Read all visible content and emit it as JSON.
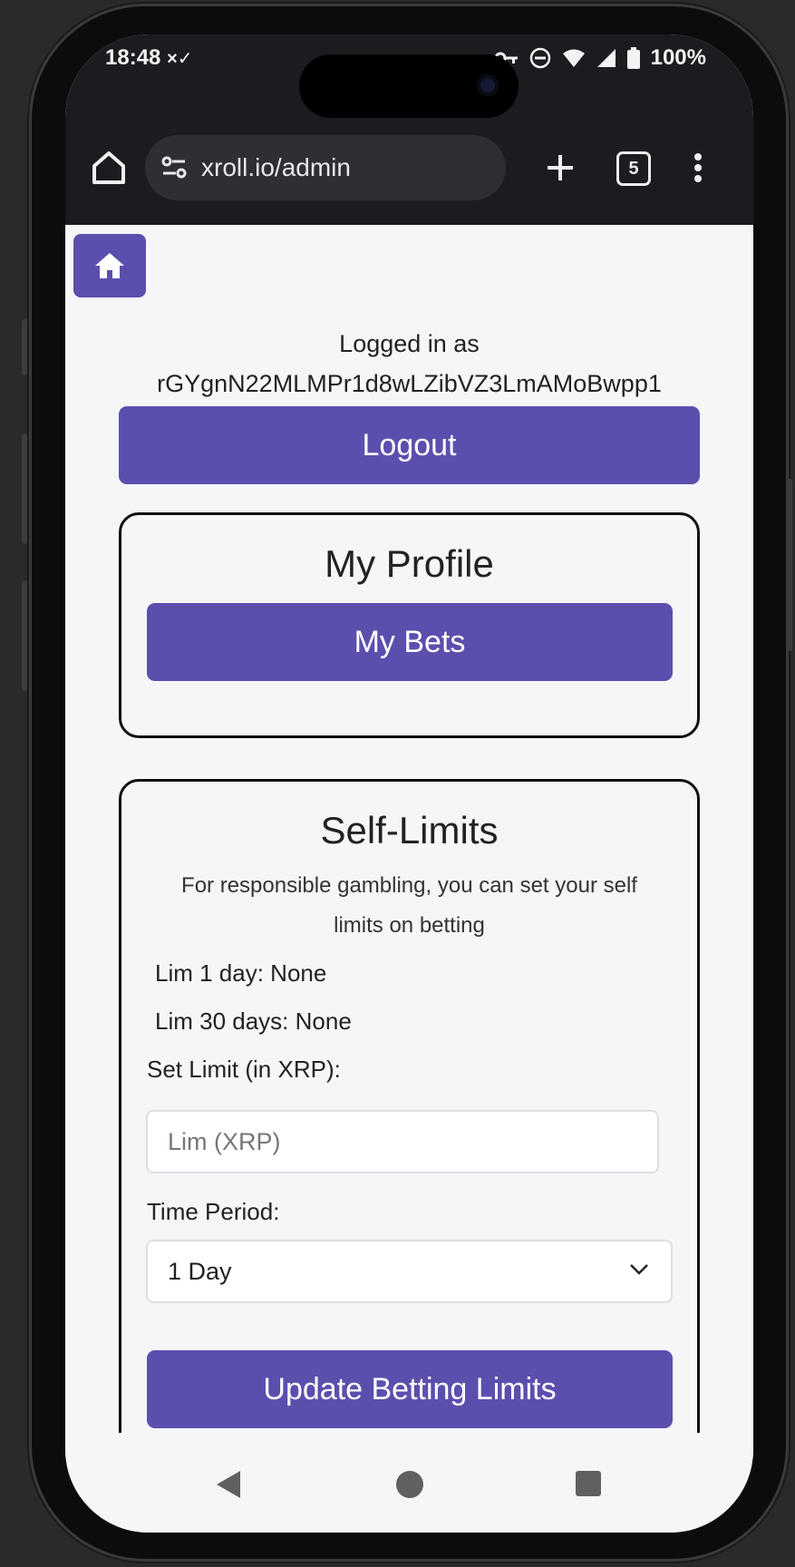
{
  "status_bar": {
    "time": "18:48",
    "battery": "100%"
  },
  "browser": {
    "url": "xroll.io/admin",
    "tab_count": "5"
  },
  "header": {
    "logged_label": "Logged in as",
    "account": "rGYgnN22MLMPr1d8wLZibVZ3LmAMoBwpp1",
    "logout_label": "Logout"
  },
  "profile": {
    "title": "My Profile",
    "bets_label": "My Bets"
  },
  "limits": {
    "title": "Self-Limits",
    "description_line1": "For responsible gambling, you can set your self",
    "description_line2": "limits on betting",
    "lim_1_day": "Lim 1 day: None",
    "lim_30_days": "Lim 30 days: None",
    "set_limit_label": "Set Limit (in XRP):",
    "limit_placeholder": "Lim (XRP)",
    "time_period_label": "Time Period:",
    "time_period_selected": "1 Day",
    "update_label": "Update Betting Limits"
  },
  "colors": {
    "accent": "#5b4fae",
    "chrome_dark": "#1b1c20"
  }
}
